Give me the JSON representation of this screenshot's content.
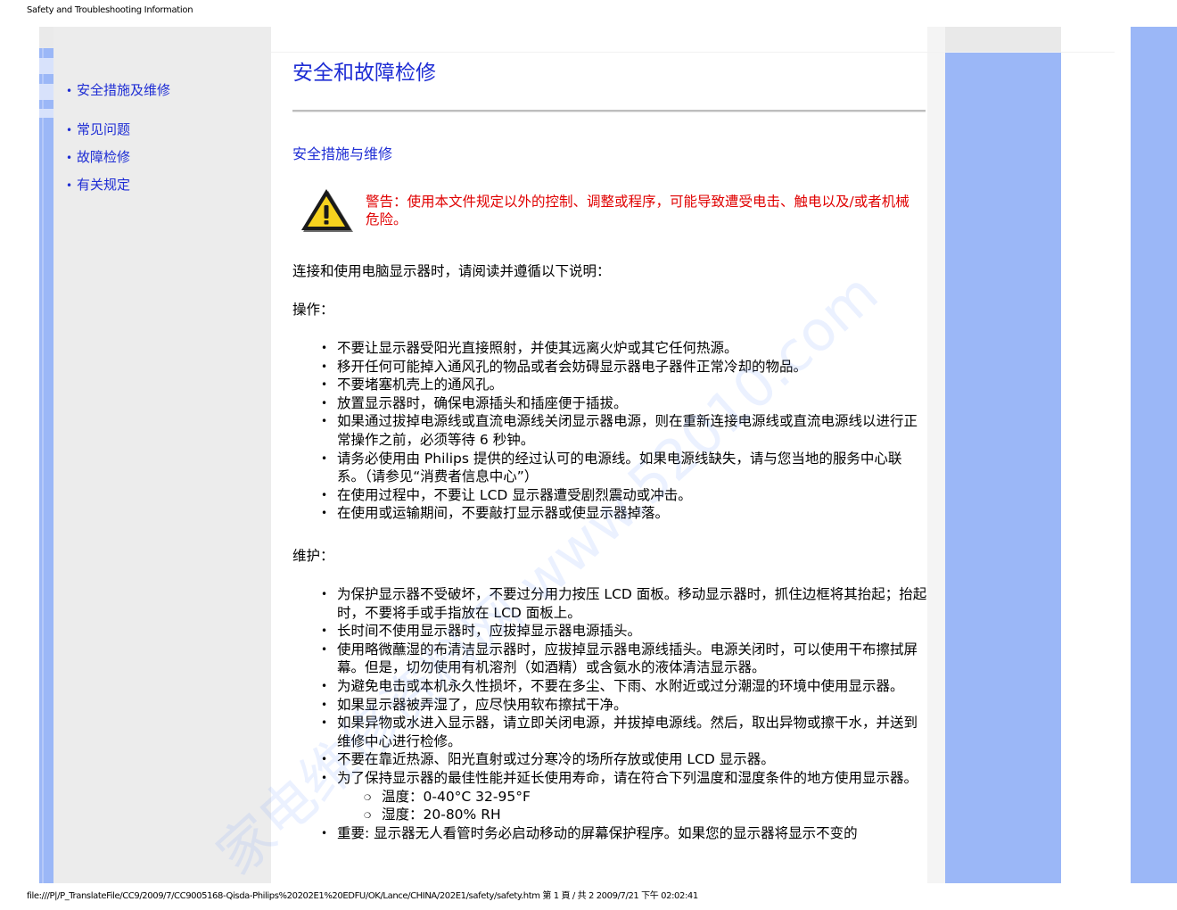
{
  "print_header": "Safety and Troubleshooting Information",
  "print_footer": "file:///P|/P_TranslateFile/CC9/2009/7/CC9005168-Qisda-Philips%20202E1%20EDFU/OK/Lance/CHINA/202E1/safety/safety.htm 第 1 頁 / 共 2 2009/7/21 下午 02:02:41",
  "watermark": "家电维修资料网 www.52010.com",
  "colors": {
    "link": "#1e2dd4",
    "warning": "#e00000",
    "sidebar_bg": "#ececec",
    "accent_blue": "#9bb7f7"
  },
  "sidebar": {
    "items": [
      {
        "label": "安全措施及维修"
      },
      {
        "label": "常见问题"
      },
      {
        "label": "故障检修"
      },
      {
        "label": "有关规定"
      }
    ]
  },
  "main": {
    "title": "安全和故障检修",
    "section_title": "安全措施与维修",
    "warning_icon": "warning-triangle-icon",
    "warning": "警告：使用本文件规定以外的控制、调整或程序，可能导致遭受电击、触电以及/或者机械危险。",
    "intro": "连接和使用电脑显示器时，请阅读并遵循以下说明：",
    "operation_heading": "操作：",
    "operation_items": [
      "不要让显示器受阳光直接照射，并使其远离火炉或其它任何热源。",
      "移开任何可能掉入通风孔的物品或者会妨碍显示器电子器件正常冷却的物品。",
      "不要堵塞机壳上的通风孔。",
      "放置显示器时，确保电源插头和插座便于插拔。",
      "如果通过拔掉电源线或直流电源线关闭显示器电源，则在重新连接电源线或直流电源线以进行正常操作之前，必须等待 6 秒钟。",
      "请务必使用由 Philips 提供的经过认可的电源线。如果电源线缺失，请与您当地的服务中心联系。（请参见“消费者信息中心”）",
      "在使用过程中，不要让 LCD 显示器遭受剧烈震动或冲击。",
      "在使用或运输期间，不要敲打显示器或使显示器掉落。"
    ],
    "maintenance_heading": "维护：",
    "maintenance_items": [
      "为保护显示器不受破坏，不要过分用力按压 LCD 面板。移动显示器时，抓住边框将其抬起；抬起时，不要将手或手指放在 LCD 面板上。",
      "长时间不使用显示器时，应拔掉显示器电源插头。",
      "使用略微蘸湿的布清洁显示器时，应拔掉显示器电源线插头。电源关闭时，可以使用干布擦拭屏幕。但是，切勿使用有机溶剂（如酒精）或含氨水的液体清洁显示器。",
      "为避免电击或本机永久性损坏，不要在多尘、下雨、水附近或过分潮湿的环境中使用显示器。",
      "如果显示器被弄湿了，应尽快用软布擦拭干净。",
      "如果异物或水进入显示器，请立即关闭电源，并拔掉电源线。然后，取出异物或擦干水，并送到维修中心进行检修。",
      "不要在靠近热源、阳光直射或过分寒冷的场所存放或使用 LCD 显示器。",
      "为了保持显示器的最佳性能并延长使用寿命，请在符合下列温度和湿度条件的地方使用显示器。"
    ],
    "conditions": [
      "温度：0-40°C 32-95°F",
      "湿度：20-80% RH"
    ],
    "last_item": "重要: 显示器无人看管时务必启动移动的屏幕保护程序。如果您的显示器将显示不变的"
  }
}
